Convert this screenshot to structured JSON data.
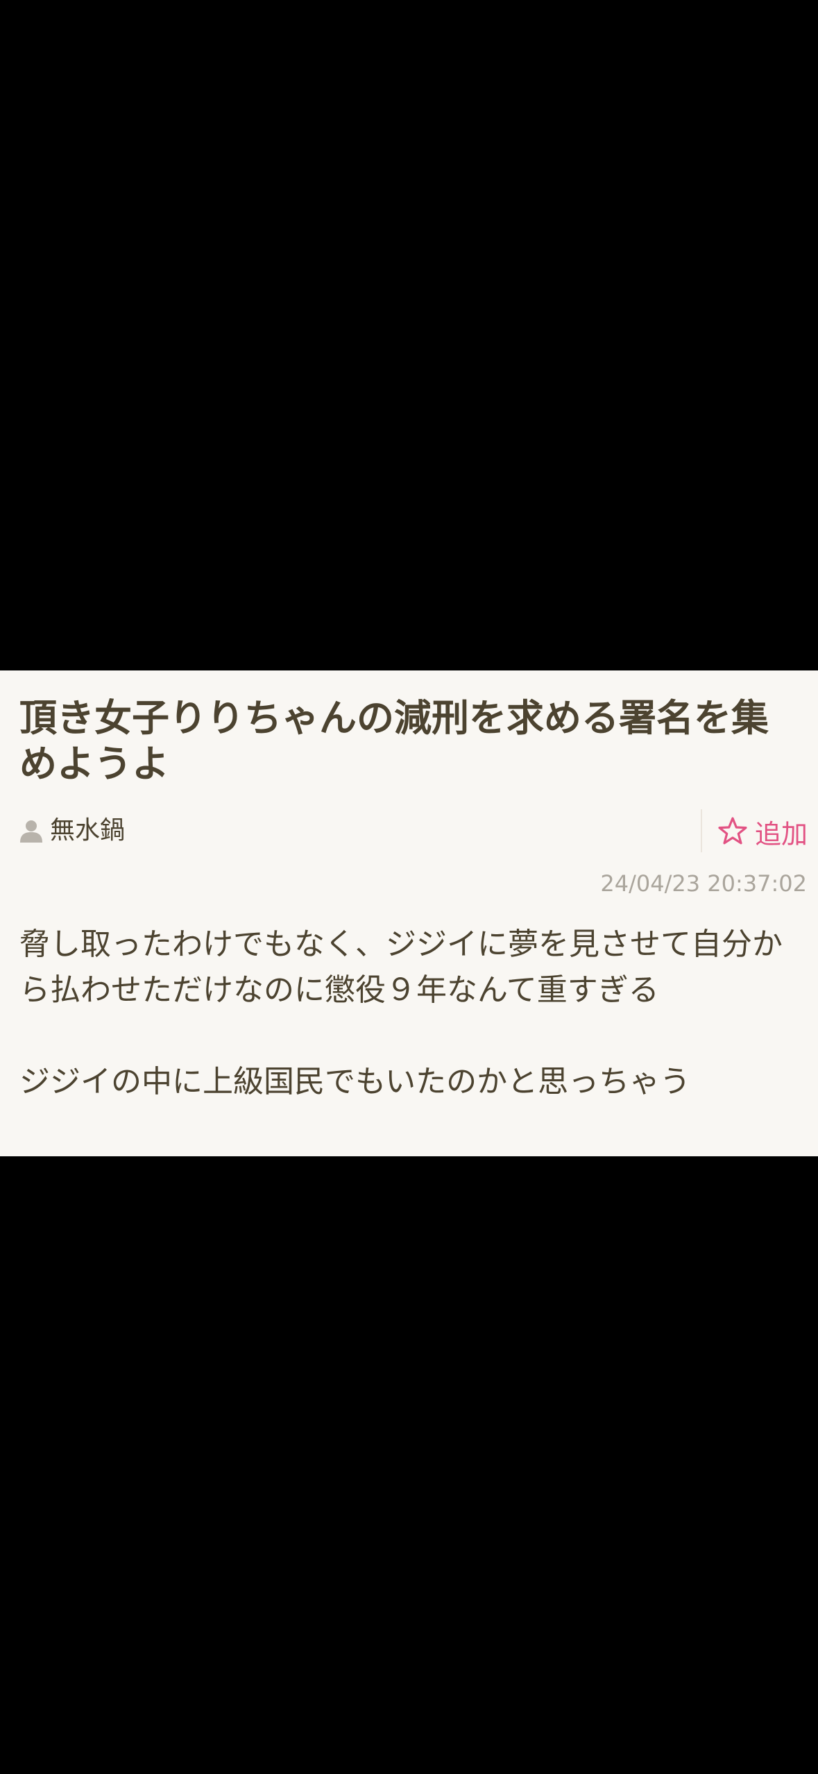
{
  "post": {
    "title": "頂き女子りりちゃんの減刑を求める署名を集めようよ",
    "author": "無水鍋",
    "add_label": "追加",
    "timestamp": "24/04/23 20:37:02",
    "body_paragraph_1": "脅し取ったわけでもなく、ジジイに夢を見させて自分から払わせただけなのに懲役９年なんて重すぎる",
    "body_paragraph_2": "ジジイの中に上級国民でもいたのかと思っちゃう"
  },
  "colors": {
    "card_background": "#f9f7f3",
    "text": "#4c4330",
    "accent": "#e25283",
    "muted": "#aaa59c"
  }
}
